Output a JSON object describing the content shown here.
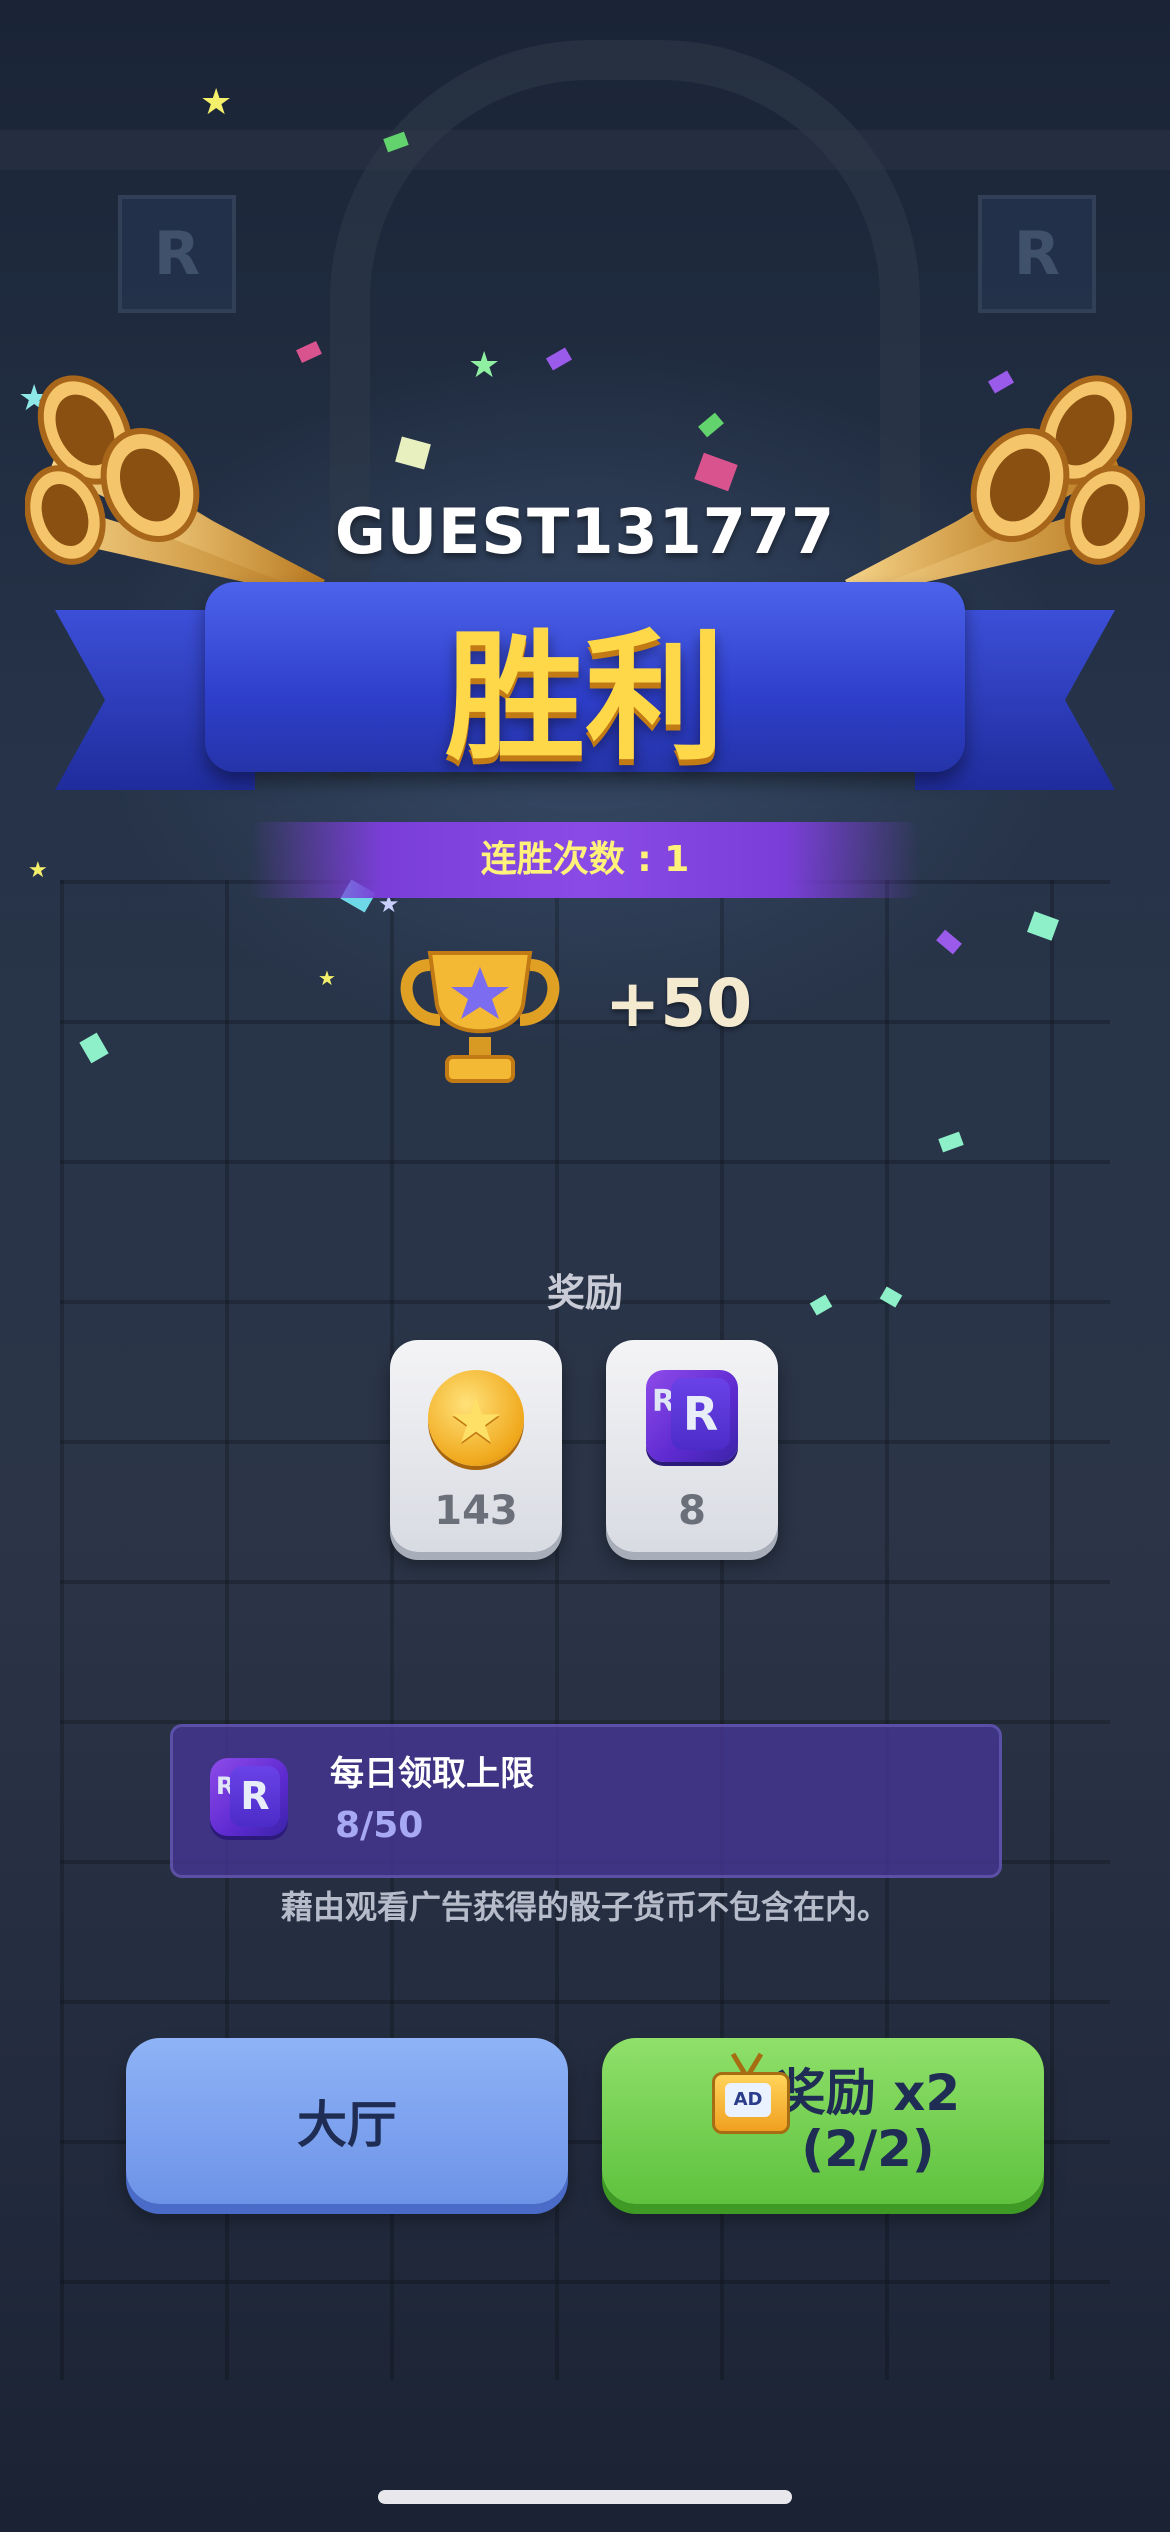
{
  "player": {
    "name": "GUEST131777"
  },
  "result": {
    "title": "胜利",
    "streak_label": "连胜次数 : 1"
  },
  "trophy": {
    "points": "+50"
  },
  "rewards": {
    "title": "奖励",
    "items": [
      {
        "icon": "coin-icon",
        "value": "143"
      },
      {
        "icon": "dice-icon",
        "value": "8"
      }
    ]
  },
  "daily_limit": {
    "title": "每日领取上限",
    "value": "8/50",
    "icon_letter": "R"
  },
  "note": "藉由观看广告获得的骰子货币不包含在内。",
  "buttons": {
    "lobby": "大厅",
    "double_line1": "奖励 x2",
    "double_line2": "(2/2)",
    "ad_label": "AD"
  },
  "colors": {
    "ribbon": "#3a4ee0",
    "victory_text": "#ffd84a",
    "streak_bar": "#8a4ae6",
    "lobby_button": "#7ea3ef",
    "double_button": "#73d04f"
  }
}
